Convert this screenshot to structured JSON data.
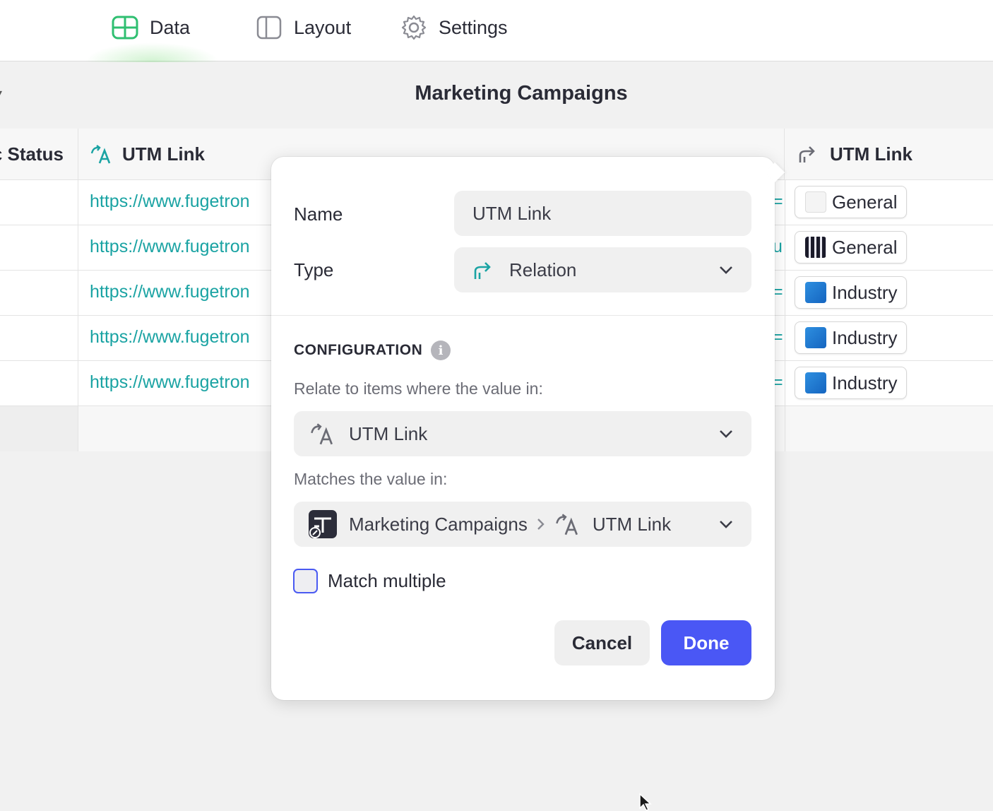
{
  "tabs": [
    {
      "label": "Data",
      "icon": "table-icon",
      "active": true,
      "accent": "#2fbf71"
    },
    {
      "label": "Layout",
      "icon": "layout-icon",
      "active": false
    },
    {
      "label": "Settings",
      "icon": "gear-icon",
      "active": false
    }
  ],
  "page": {
    "title": "Marketing Campaigns"
  },
  "table": {
    "headers": {
      "status": "Status",
      "utm": "UTM Link",
      "relation": "UTM Link"
    },
    "rows": [
      {
        "link": "https://www.fugetron",
        "trunc": "=|",
        "chip": "General"
      },
      {
        "link": "https://www.fugetron",
        "trunc": "u",
        "chip": "General"
      },
      {
        "link": "https://www.fugetron",
        "trunc": "=|",
        "chip": "Industry"
      },
      {
        "link": "https://www.fugetron",
        "trunc": "=|",
        "chip": "Industry"
      },
      {
        "link": "https://www.fugetron",
        "trunc": "=|",
        "chip": "Industry"
      }
    ]
  },
  "dialog": {
    "name_label": "Name",
    "name_value": "UTM Link",
    "type_label": "Type",
    "type_value": "Relation",
    "config_title": "CONFIGURATION",
    "relate_hint": "Relate to items where the value in:",
    "relate_value": "UTM Link",
    "matches_hint": "Matches the value in:",
    "match_table": "Marketing Campaigns",
    "match_field": "UTM Link",
    "match_multiple_label": "Match multiple",
    "match_multiple_checked": false,
    "cancel_label": "Cancel",
    "done_label": "Done",
    "done_color": "#4a57f5",
    "link_color": "#1aa3a3"
  }
}
